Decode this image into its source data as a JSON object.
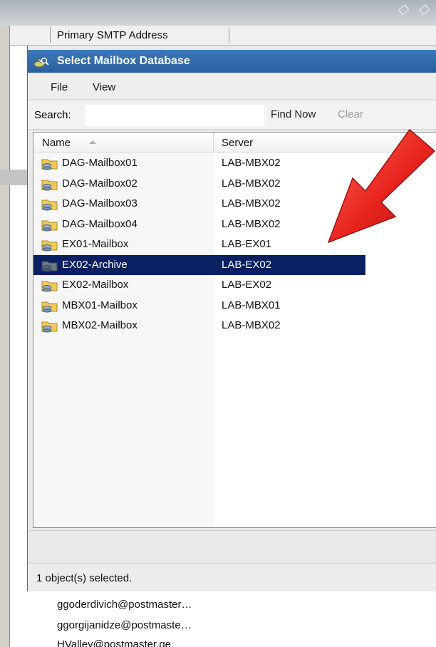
{
  "background": {
    "column_header": "Primary SMTP Address",
    "rows": [
      "ggoderdivich@postmaster…",
      "ggorgijanidze@postmaste…",
      "HValley@postmaster.ge"
    ]
  },
  "dialog": {
    "title": "Select Mailbox Database",
    "menu": {
      "file": "File",
      "view": "View"
    },
    "search": {
      "label": "Search:",
      "value": "",
      "find_now": "Find Now",
      "clear": "Clear"
    },
    "columns": {
      "name": "Name",
      "server": "Server"
    },
    "rows": [
      {
        "name": "DAG-Mailbox01",
        "server": "LAB-MBX02",
        "icon": "database-icon",
        "selected": false
      },
      {
        "name": "DAG-Mailbox02",
        "server": "LAB-MBX02",
        "icon": "database-icon",
        "selected": false
      },
      {
        "name": "DAG-Mailbox03",
        "server": "LAB-MBX02",
        "icon": "database-icon",
        "selected": false
      },
      {
        "name": "DAG-Mailbox04",
        "server": "LAB-MBX02",
        "icon": "database-icon",
        "selected": false
      },
      {
        "name": "EX01-Mailbox",
        "server": "LAB-EX01",
        "icon": "database-icon",
        "selected": false
      },
      {
        "name": "EX02-Archive",
        "server": "LAB-EX02",
        "icon": "database-icon",
        "selected": true
      },
      {
        "name": "EX02-Mailbox",
        "server": "LAB-EX02",
        "icon": "database-icon",
        "selected": false
      },
      {
        "name": "MBX01-Mailbox",
        "server": "LAB-MBX01",
        "icon": "database-icon",
        "selected": false
      },
      {
        "name": "MBX02-Mailbox",
        "server": "LAB-MBX02",
        "icon": "database-icon",
        "selected": false
      }
    ],
    "status": "1 object(s) selected."
  },
  "colors": {
    "titlebar": "#2f68aa",
    "selection": "#0a2062",
    "arrow": "#e8231d"
  }
}
